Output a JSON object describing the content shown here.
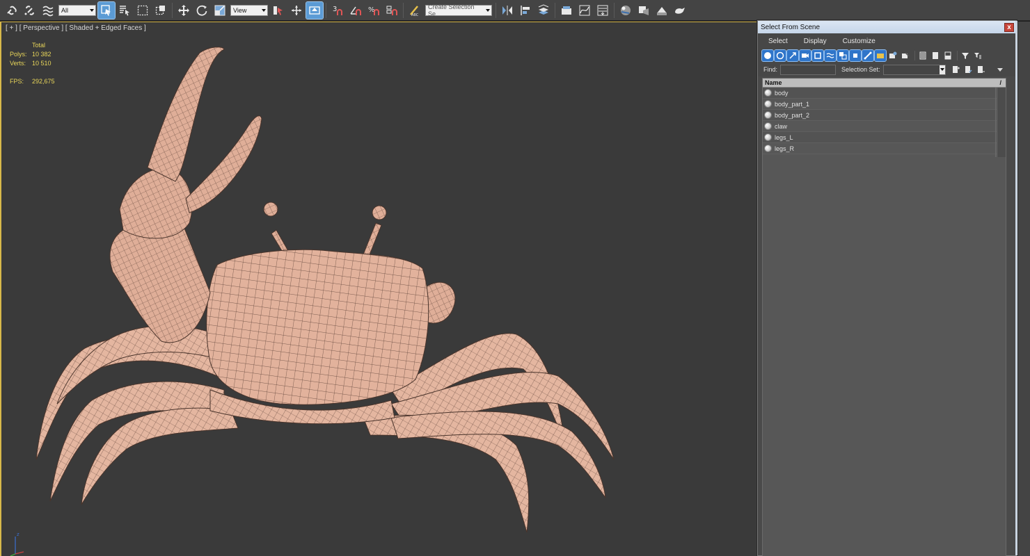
{
  "toolbar": {
    "filter_value": "All",
    "coord_value": "View",
    "selection_set_placeholder": "Create Selection Se",
    "snap_label": "3"
  },
  "viewport": {
    "label": "[ + ] [ Perspective ] [ Shaded + Edged Faces ]",
    "stats": {
      "header": "Total",
      "polys_label": "Polys:",
      "polys_value": "10 382",
      "verts_label": "Verts:",
      "verts_value": "10 510",
      "fps_label": "FPS:",
      "fps_value": "292,675"
    }
  },
  "dialog": {
    "title": "Select From Scene",
    "close": "x",
    "menu": [
      "Select",
      "Display",
      "Customize"
    ],
    "find_label": "Find:",
    "selection_set_label": "Selection Set:",
    "column_name": "Name",
    "column_sort": "/",
    "objects": [
      "body",
      "body_part_1",
      "body_part_2",
      "claw",
      "legs_L",
      "legs_R"
    ]
  },
  "colors": {
    "viewport_bg": "#3a3a3a",
    "stats_yellow": "#e9d65a",
    "active_border": "#d8b84a",
    "mesh_fill": "#e2b29c",
    "mesh_line": "#5a4036",
    "highlight_blue": "#2f75c9"
  }
}
